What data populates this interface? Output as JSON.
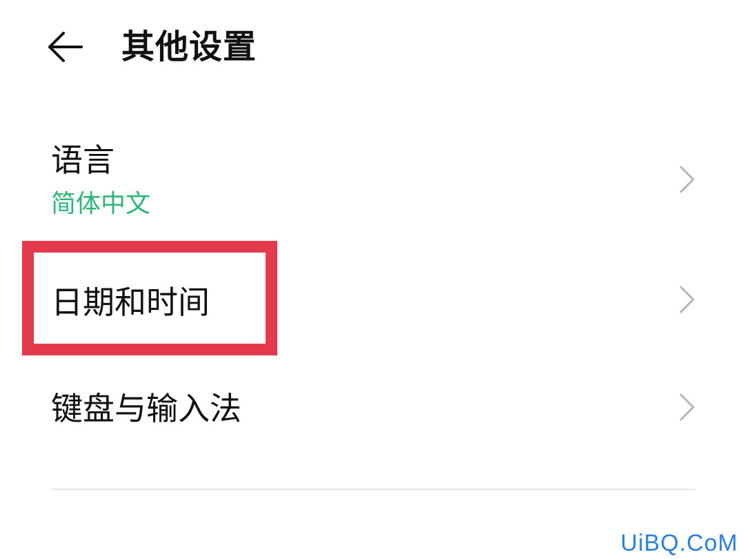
{
  "header": {
    "back_icon": "arrow-left-icon",
    "title": "其他设置"
  },
  "settings": {
    "items": [
      {
        "title": "语言",
        "subtitle": "简体中文",
        "chevron_icon": "chevron-right-icon"
      },
      {
        "title": "日期和时间",
        "chevron_icon": "chevron-right-icon"
      },
      {
        "title": "键盘与输入法",
        "chevron_icon": "chevron-right-icon"
      }
    ]
  },
  "watermark": {
    "text": "UiBQ.CoM"
  },
  "colors": {
    "subtitle_accent": "#2db87a",
    "highlight_box": "#e33a4d",
    "watermark": "#2a7fd9",
    "chevron": "#b5b5b5",
    "divider": "#e4e4e4"
  }
}
